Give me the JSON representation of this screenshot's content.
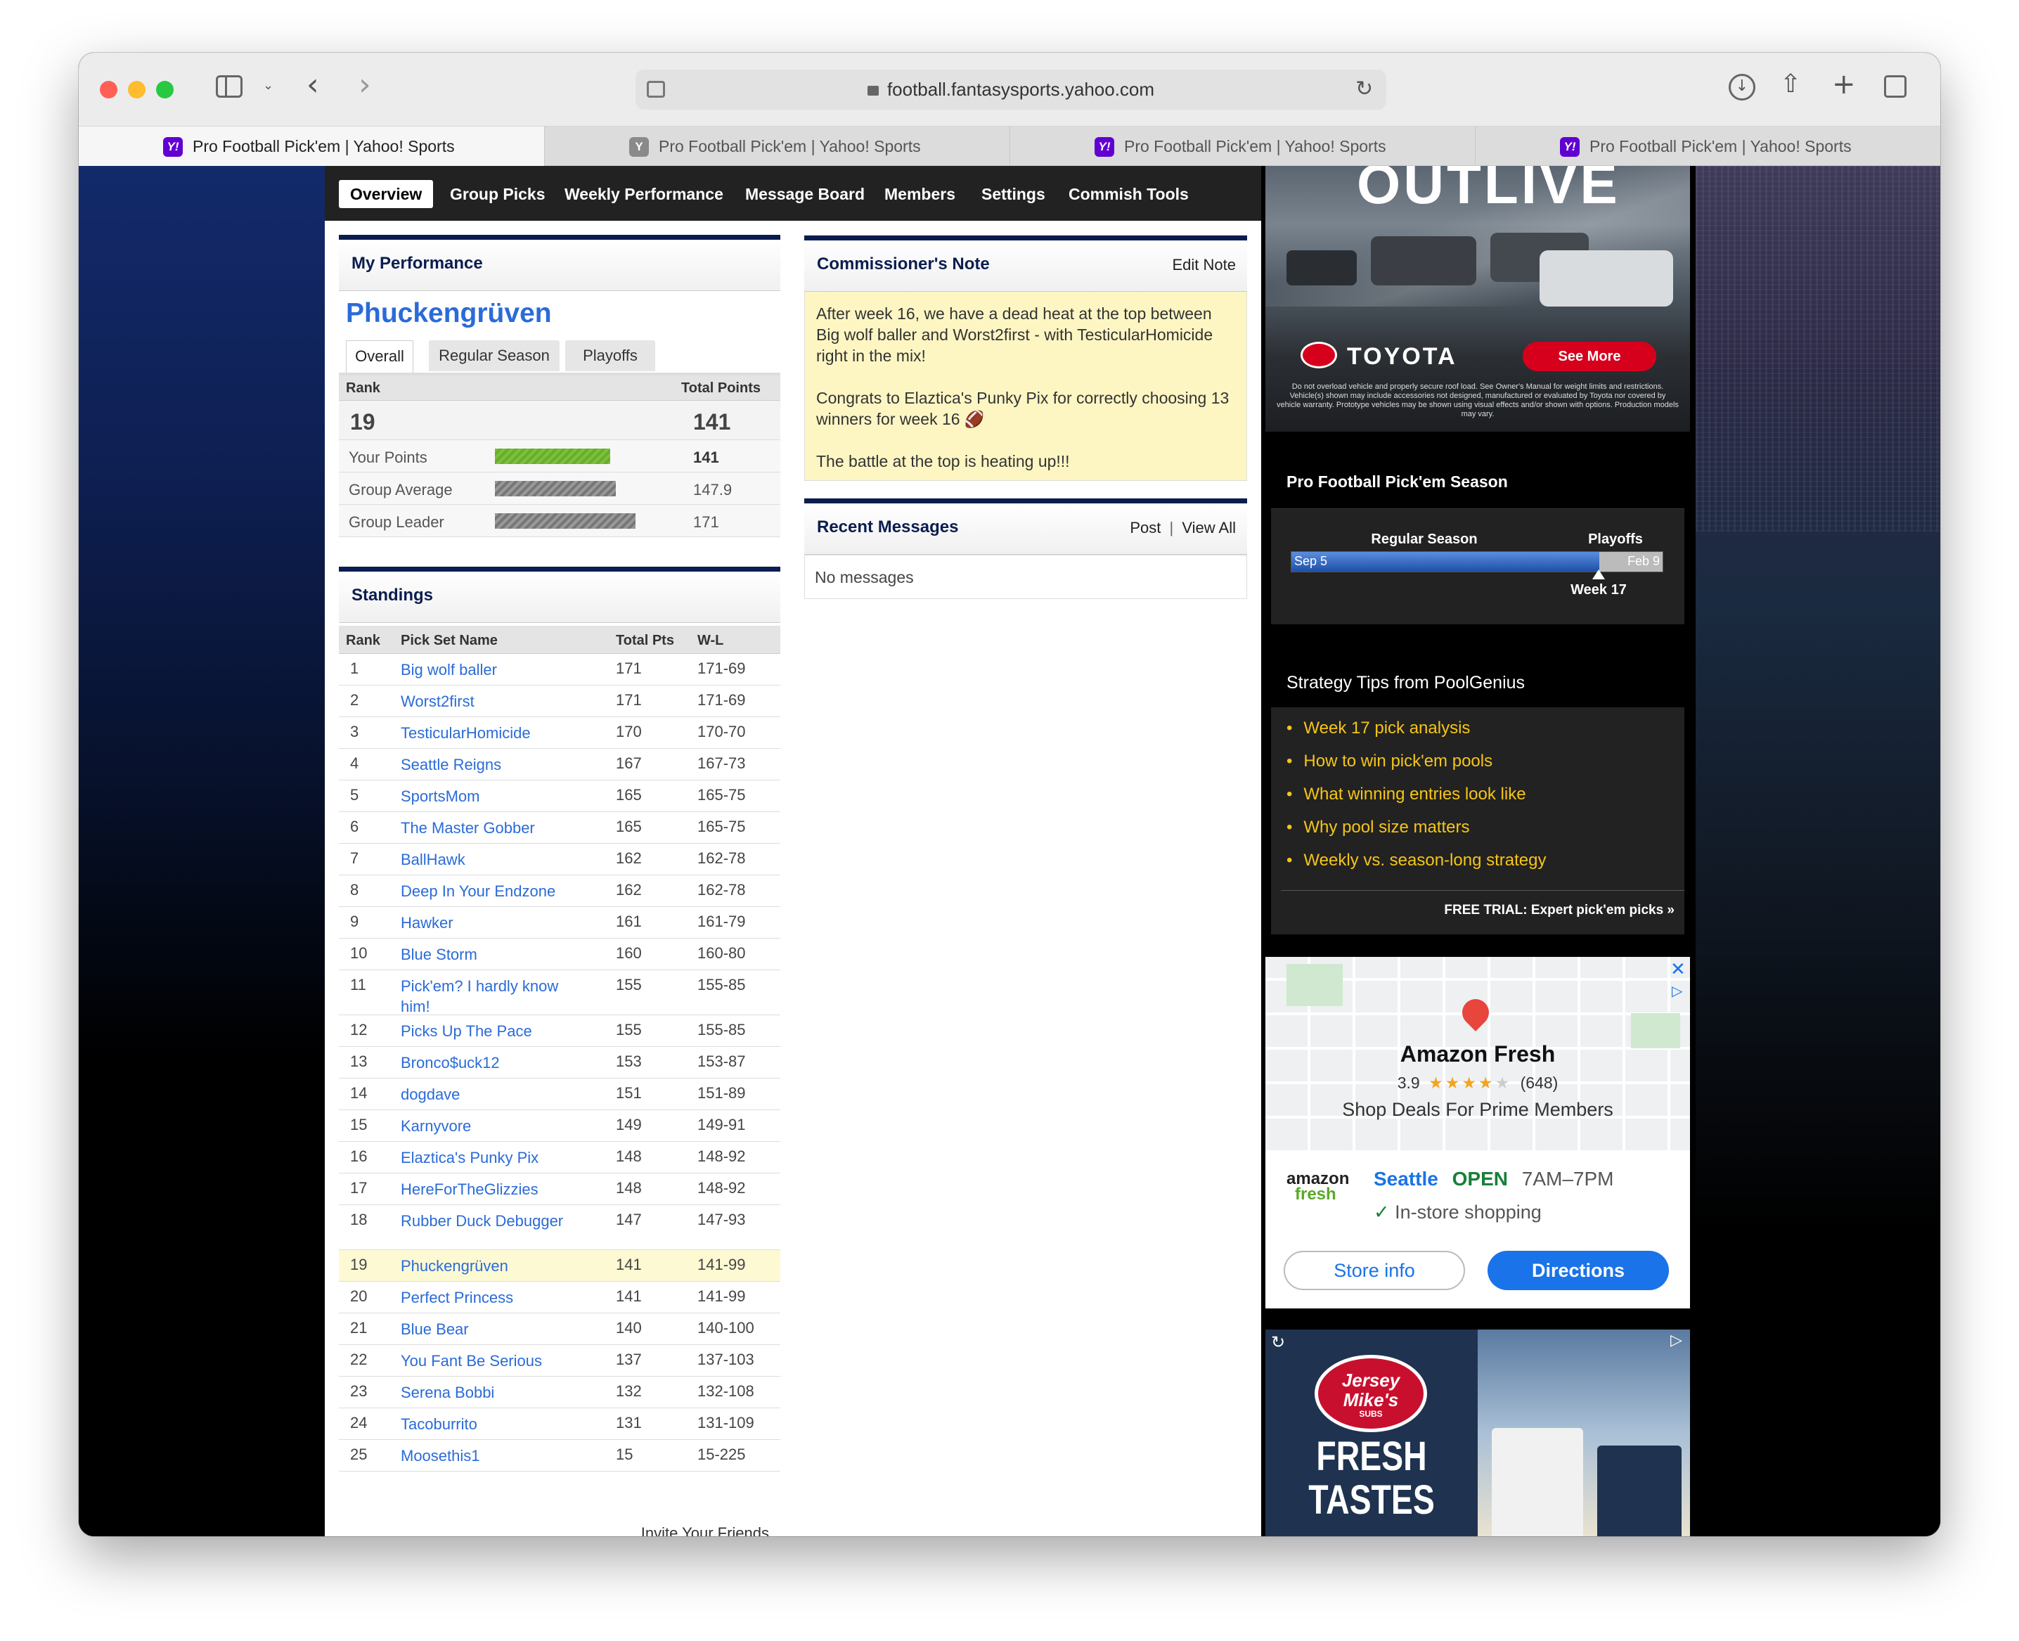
{
  "browser": {
    "url": "football.fantasysports.yahoo.com",
    "tabs": [
      {
        "title": "Pro Football Pick'em | Yahoo! Sports",
        "favicon": "Y!",
        "active": true
      },
      {
        "title": "Pro Football Pick'em | Yahoo! Sports",
        "favicon": "Y",
        "active": false
      },
      {
        "title": "Pro Football Pick'em | Yahoo! Sports",
        "favicon": "Y!",
        "active": false
      },
      {
        "title": "Pro Football Pick'em | Yahoo! Sports",
        "favicon": "Y!",
        "active": false
      }
    ],
    "tab_close": "×"
  },
  "nav": [
    "Overview",
    "Group Picks",
    "Weekly Performance",
    "Message Board",
    "Members",
    "Settings",
    "Commish Tools"
  ],
  "performance": {
    "heading": "My Performance",
    "team_name": "Phuckengrüven",
    "tabs": [
      "Overall",
      "Regular Season",
      "Playoffs"
    ],
    "rank_label": "Rank",
    "total_points_label": "Total Points",
    "rank": "19",
    "total_points": "141",
    "bars": [
      {
        "label": "Your Points",
        "value": "141",
        "fraction": 0.82
      },
      {
        "label": "Group Average",
        "value": "147.9",
        "fraction": 0.86
      },
      {
        "label": "Group Leader",
        "value": "171",
        "fraction": 1.0
      }
    ]
  },
  "standings": {
    "heading": "Standings",
    "columns": [
      "Rank",
      "Pick Set Name",
      "Total Pts",
      "W-L"
    ],
    "rows": [
      [
        "1",
        "Big wolf baller",
        "171",
        "171-69"
      ],
      [
        "2",
        "Worst2first",
        "171",
        "171-69"
      ],
      [
        "3",
        "TesticularHomicide",
        "170",
        "170-70"
      ],
      [
        "4",
        "Seattle Reigns",
        "167",
        "167-73"
      ],
      [
        "5",
        "SportsMom",
        "165",
        "165-75"
      ],
      [
        "6",
        "The Master Gobber",
        "165",
        "165-75"
      ],
      [
        "7",
        "BallHawk",
        "162",
        "162-78"
      ],
      [
        "8",
        "Deep In Your Endzone",
        "162",
        "162-78"
      ],
      [
        "9",
        "Hawker",
        "161",
        "161-79"
      ],
      [
        "10",
        "Blue Storm",
        "160",
        "160-80"
      ],
      [
        "11",
        "Pick'em? I hardly know him!",
        "155",
        "155-85"
      ],
      [
        "12",
        "Picks Up The Pace",
        "155",
        "155-85"
      ],
      [
        "13",
        "Bronco$uck12",
        "153",
        "153-87"
      ],
      [
        "14",
        "dogdave",
        "151",
        "151-89"
      ],
      [
        "15",
        "Karnyvore",
        "149",
        "149-91"
      ],
      [
        "16",
        "Elaztica's Punky Pix",
        "148",
        "148-92"
      ],
      [
        "17",
        "HereForTheGlizzies",
        "148",
        "148-92"
      ],
      [
        "18",
        "Rubber Duck Debugger",
        "147",
        "147-93"
      ],
      [
        "19",
        "Phuckengrüven",
        "141",
        "141-99"
      ],
      [
        "20",
        "Perfect Princess",
        "141",
        "141-99"
      ],
      [
        "21",
        "Blue Bear",
        "140",
        "140-100"
      ],
      [
        "22",
        "You Fant Be Serious",
        "137",
        "137-103"
      ],
      [
        "23",
        "Serena Bobbi",
        "132",
        "132-108"
      ],
      [
        "24",
        "Tacoburrito",
        "131",
        "131-109"
      ],
      [
        "25",
        "Moosethis1",
        "15",
        "15-225"
      ]
    ],
    "highlight_rank": "19",
    "invite": "Invite Your Friends"
  },
  "commissioner": {
    "heading": "Commissioner's Note",
    "edit": "Edit Note",
    "paragraphs": [
      "After week 16, we have a dead heat at the top between Big wolf baller and Worst2first - with TesticularHomicide right in the mix!",
      "Congrats to Elaztica's Punky Pix for correctly choosing 13 winners for week 16 🏈",
      "The battle at the top is heating up!!!"
    ]
  },
  "messages": {
    "heading": "Recent Messages",
    "post": "Post",
    "separator": "|",
    "view_all": "View All",
    "empty": "No messages"
  },
  "toyota_ad": {
    "headline": "OUTLIVE",
    "brand": "TOYOTA",
    "cta": "See More",
    "disclaimer": "Do not overload vehicle and properly secure roof load. See Owner's Manual for weight limits and restrictions. Vehicle(s) shown may include accessories not designed, manufactured or evaluated by Toyota nor covered by vehicle warranty. Prototype vehicles may be shown using visual effects and/or shown with options. Production models may vary."
  },
  "season": {
    "heading": "Pro Football Pick'em Season",
    "regular_label": "Regular Season",
    "playoffs_label": "Playoffs",
    "start": "Sep 5",
    "end": "Feb 9",
    "current": "Week 17",
    "progress": 0.83
  },
  "tips": {
    "heading": "Strategy Tips from PoolGenius",
    "items": [
      "Week 17 pick analysis",
      "How to win pick'em pools",
      "What winning entries look like",
      "Why pool size matters",
      "Weekly vs. season-long strategy"
    ],
    "trial": "FREE TRIAL: Expert pick'em picks »"
  },
  "amazon_ad": {
    "name": "Amazon Fresh",
    "rating": "3.9",
    "stars_filled": 4,
    "review_count": "(648)",
    "tagline": "Shop Deals For Prime Members",
    "logo_top": "amazon",
    "logo_bottom": "fresh",
    "city": "Seattle",
    "open": "OPEN",
    "hours": "7AM–7PM",
    "feature": "In-store shopping",
    "store_info": "Store info",
    "directions": "Directions"
  },
  "jersey_ad": {
    "logo_line1": "Jersey",
    "logo_line2": "Mike's",
    "logo_line3": "SUBS",
    "headline1": "FRESH",
    "headline2": "TASTES"
  },
  "colors": {
    "navy": "#0b1d4f",
    "link": "#2a6bd8",
    "highlight": "#fdf9d3",
    "note_bg": "#fdf6c3",
    "tip_link": "#f5c518",
    "green_bar": "#7cc13b",
    "directions_blue": "#1a73e8"
  }
}
